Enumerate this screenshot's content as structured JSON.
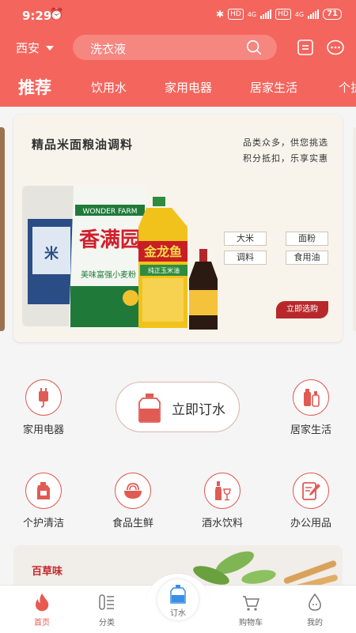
{
  "status_bar": {
    "time": "9:29",
    "hd1": "HD",
    "net1": "4G",
    "hd2": "HD",
    "net2": "4G",
    "battery": "71"
  },
  "header": {
    "city": "西安",
    "search_placeholder": "洗衣液"
  },
  "tabs": [
    "推荐",
    "饮用水",
    "家用电器",
    "居家生活",
    "个护"
  ],
  "banner": {
    "title": "精品米面粮油调料",
    "subtitle_line1": "品类众多，供您挑选",
    "subtitle_line2": "积分抵扣，乐享实惠",
    "tags": [
      "大米",
      "面粉",
      "调料",
      "食用油"
    ],
    "cta": "立即选购",
    "product_text_1": "WONDER FARM",
    "product_text_2": "香满园",
    "product_text_3": "美味富强小麦粉",
    "product_text_4": "金龙鱼",
    "product_text_5": "纯正玉米油"
  },
  "categories": {
    "row1_left": "家用电器",
    "order_water": "立即订水",
    "row1_right": "居家生活",
    "row2": [
      "个护清洁",
      "食品生鲜",
      "酒水饮料",
      "办公用品"
    ]
  },
  "promo": {
    "logo": "百草味"
  },
  "bottom_nav": {
    "home": "首页",
    "category": "分类",
    "order_water": "订水",
    "cart": "购物车",
    "mine": "我的"
  },
  "colors": {
    "brand_red": "#f4655d",
    "accent_red": "#e05b54",
    "cta_red": "#b8282a"
  }
}
